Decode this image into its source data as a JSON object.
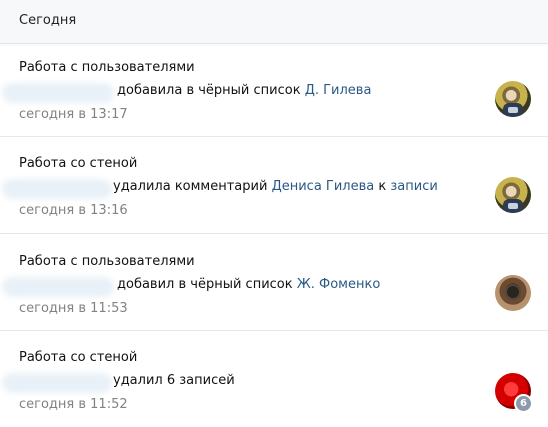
{
  "header": {
    "title": "Сегодня"
  },
  "entries": [
    {
      "category": "Работа с пользователями",
      "action": "добавила в чёрный список",
      "target": "Д. Гилева",
      "time": "сегодня в 13:17",
      "avatar_icon": "user-avatar"
    },
    {
      "category": "Работа со стеной",
      "action": "удалила комментарий",
      "target": "Дениса Гилева",
      "connector": "к",
      "target2": "записи",
      "time": "сегодня в 13:16",
      "avatar_icon": "user-avatar"
    },
    {
      "category": "Работа с пользователями",
      "action": "добавил в чёрный список",
      "target": "Ж. Фоменко",
      "time": "сегодня в 11:53",
      "avatar_icon": "user-avatar"
    },
    {
      "category": "Работа со стеной",
      "action": "удалил 6 записей",
      "time": "сегодня в 11:52",
      "avatar_icon": "user-avatar",
      "badge": "6"
    }
  ],
  "colors": {
    "link": "#2a5885",
    "muted": "#828282",
    "divider": "#e7e8ec"
  }
}
